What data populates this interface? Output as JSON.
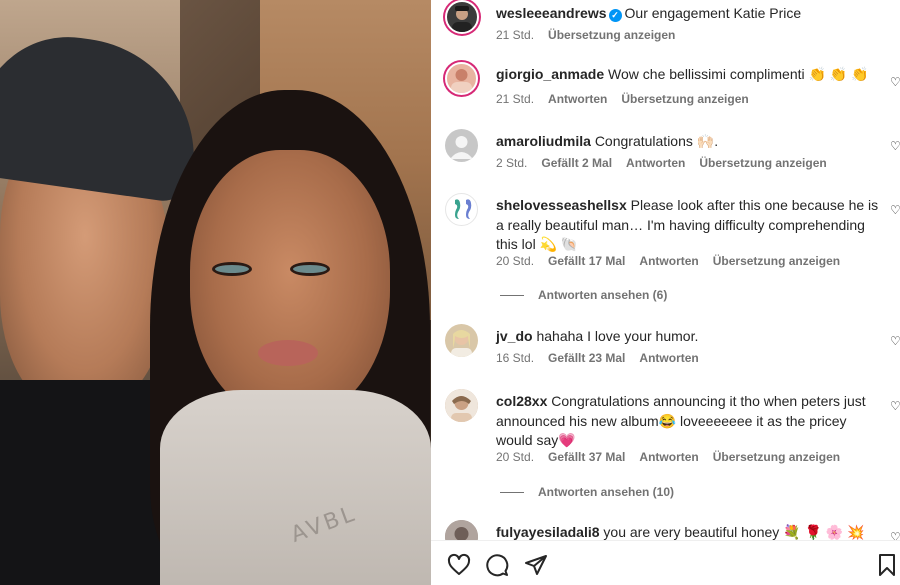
{
  "post": {
    "author": "wesleeeandrews",
    "caption": "Our engagement Katie Price",
    "time": "21 Std.",
    "translate": "Übersetzung anzeigen"
  },
  "photo": {
    "print_text": "AVBL"
  },
  "comments": [
    {
      "user": "giorgio_anmade",
      "text": "Wow che bellissimi complimenti 👏 👏 👏",
      "time": "21 Std.",
      "likes": "",
      "reply": "Antworten",
      "translate": "Übersetzung anzeigen",
      "avatar_color": "#e8b4a0"
    },
    {
      "user": "amaroliudmila",
      "text": "Congratulations 🙌🏻.",
      "time": "2 Std.",
      "likes": "Gefällt 2 Mal",
      "reply": "Antworten",
      "translate": "Übersetzung anzeigen",
      "avatar_color": "#c7c7c7"
    },
    {
      "user": "shelovesseashellsx",
      "text": "Please look after this one because he is a really beautiful man… I'm having difficulty comprehending this lol 💫 🐚",
      "time": "20 Std.",
      "likes": "Gefällt 17 Mal",
      "reply": "Antworten",
      "translate": "Übersetzung anzeigen",
      "avatar_color": "#6fb8a8",
      "view_replies": "Antworten ansehen (6)"
    },
    {
      "user": "jv_do",
      "text": "hahaha I love your humor.",
      "time": "16 Std.",
      "likes": "Gefällt 23 Mal",
      "reply": "Antworten",
      "translate": "",
      "avatar_color": "#d9c7a8"
    },
    {
      "user": "col28xx",
      "text": "Congratulations announcing it tho when peters just announced his new album😂 loveeeeeee it as the pricey would say💗",
      "time": "20 Std.",
      "likes": "Gefällt 37 Mal",
      "reply": "Antworten",
      "translate": "Übersetzung anzeigen",
      "avatar_color": "#c9a88a",
      "view_replies": "Antworten ansehen (10)"
    },
    {
      "user": "fulyayesiladali8",
      "text": "you are very beautiful honey 💐 🌹 🌸 💥",
      "avatar_color": "#9a8a86"
    }
  ],
  "icons": {
    "like": "heart-icon",
    "comment": "comment-icon",
    "share": "share-icon",
    "save": "bookmark-icon",
    "verified": "verified-badge-icon"
  },
  "colors": {
    "verified": "#0095f6",
    "story_ring": "#d62976",
    "meta": "#737373"
  }
}
